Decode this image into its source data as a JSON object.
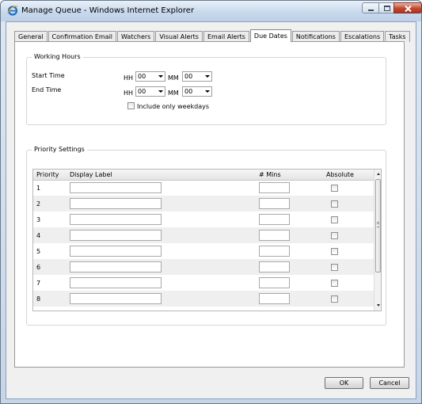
{
  "window": {
    "title": "Manage Queue - Windows Internet Explorer"
  },
  "tabs": [
    {
      "label": "General",
      "active": false
    },
    {
      "label": "Confirmation Email",
      "active": false
    },
    {
      "label": "Watchers",
      "active": false
    },
    {
      "label": "Visual Alerts",
      "active": false
    },
    {
      "label": "Email Alerts",
      "active": false
    },
    {
      "label": "Due Dates",
      "active": true
    },
    {
      "label": "Notifications",
      "active": false
    },
    {
      "label": "Escalations",
      "active": false
    },
    {
      "label": "Tasks",
      "active": false
    }
  ],
  "working_hours": {
    "legend": "Working Hours",
    "start_time_label": "Start Time",
    "end_time_label": "End Time",
    "hh_label": "HH",
    "mm_label": "MM",
    "start_hh": "00",
    "start_mm": "00",
    "end_hh": "00",
    "end_mm": "00",
    "weekdays_label": "Include only weekdays",
    "weekdays_checked": false
  },
  "priority_settings": {
    "legend": "Priority Settings",
    "columns": {
      "priority": "Priority",
      "display_label": "Display Label",
      "mins": "# Mins",
      "absolute": "Absolute"
    },
    "rows": [
      {
        "priority": "1",
        "label": "",
        "mins": "",
        "absolute": false
      },
      {
        "priority": "2",
        "label": "",
        "mins": "",
        "absolute": false
      },
      {
        "priority": "3",
        "label": "",
        "mins": "",
        "absolute": false
      },
      {
        "priority": "4",
        "label": "",
        "mins": "",
        "absolute": false
      },
      {
        "priority": "5",
        "label": "",
        "mins": "",
        "absolute": false
      },
      {
        "priority": "6",
        "label": "",
        "mins": "",
        "absolute": false
      },
      {
        "priority": "7",
        "label": "",
        "mins": "",
        "absolute": false
      },
      {
        "priority": "8",
        "label": "",
        "mins": "",
        "absolute": false
      }
    ]
  },
  "footer": {
    "ok_label": "OK",
    "cancel_label": "Cancel"
  },
  "icons": {
    "app": "internet-explorer-icon",
    "minimize": "minimize-icon",
    "maximize": "maximize-icon",
    "close": "close-icon",
    "dropdown": "chevron-down-icon"
  },
  "colors": {
    "titlebar": "#c8d9ec",
    "close_button": "#c2472f",
    "ie_logo": "#1c6fc7",
    "alt_row": "#efefef"
  }
}
